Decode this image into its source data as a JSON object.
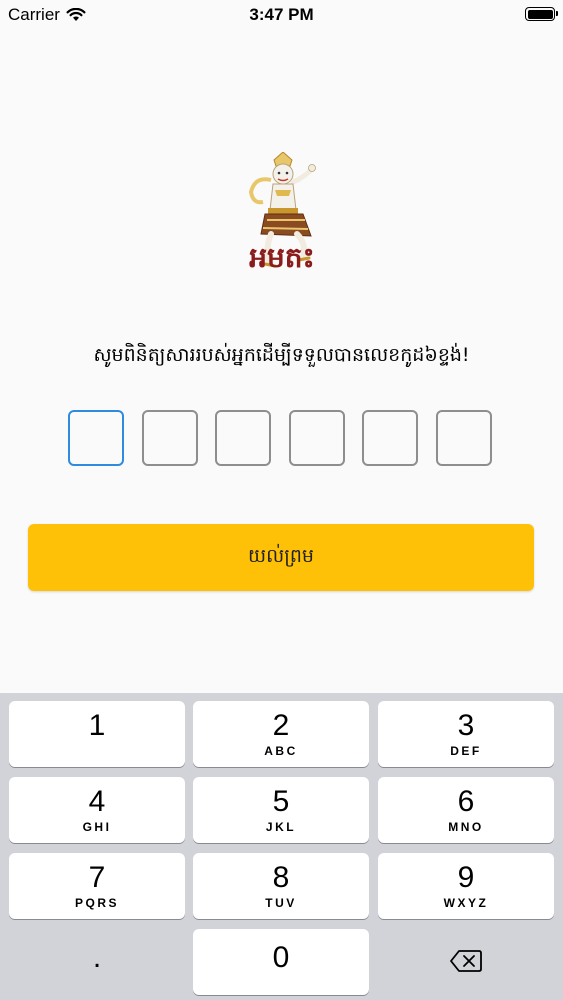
{
  "status": {
    "carrier": "Carrier",
    "time": "3:47 PM"
  },
  "logo": {
    "text": "អមតះ"
  },
  "instruction": "សូមពិនិត្យសាររបស់អ្នកដើម្បីទទួលបានលេខកូដ៦ខ្ទង់!",
  "code_boxes": 6,
  "confirm_label": "យល់ព្រម",
  "colors": {
    "accent": "#ffc107",
    "active_border": "#2f8be0",
    "box_border": "#8e8e8e",
    "logo_text": "#8a1c1c"
  },
  "keyboard": {
    "keys": [
      {
        "digit": "1",
        "letters": ""
      },
      {
        "digit": "2",
        "letters": "ABC"
      },
      {
        "digit": "3",
        "letters": "DEF"
      },
      {
        "digit": "4",
        "letters": "GHI"
      },
      {
        "digit": "5",
        "letters": "JKL"
      },
      {
        "digit": "6",
        "letters": "MNO"
      },
      {
        "digit": "7",
        "letters": "PQRS"
      },
      {
        "digit": "8",
        "letters": "TUV"
      },
      {
        "digit": "9",
        "letters": "WXYZ"
      },
      {
        "digit": ".",
        "letters": ""
      },
      {
        "digit": "0",
        "letters": ""
      }
    ],
    "delete_icon": "backspace-icon"
  }
}
